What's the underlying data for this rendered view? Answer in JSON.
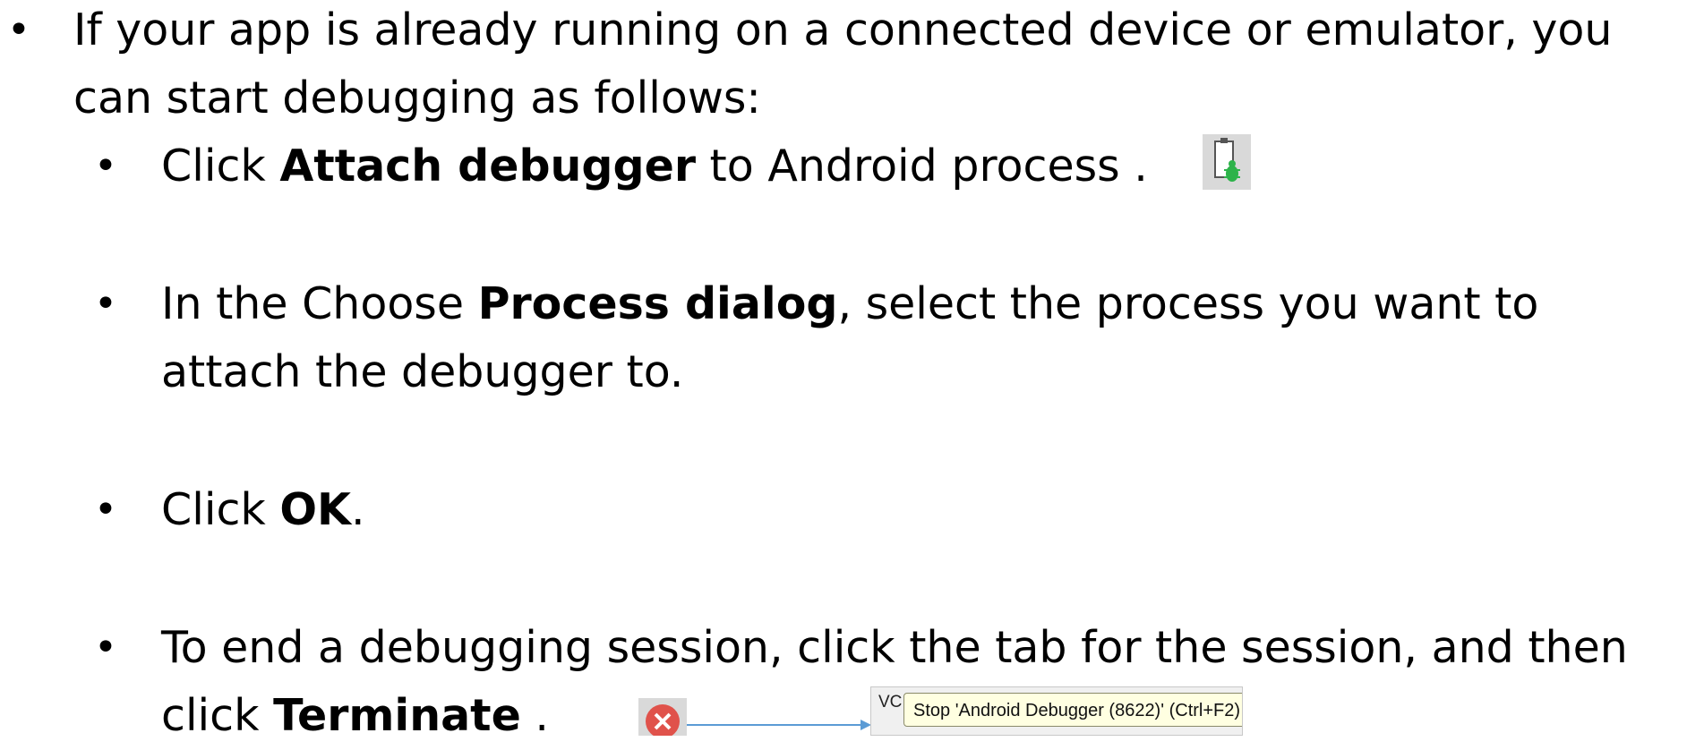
{
  "bullets": {
    "main": {
      "line1": "If your app is already running on a connected device or emulator, you",
      "line2": "can start debugging as follows:"
    },
    "attach": {
      "pre": "Click ",
      "bold": "Attach debugger",
      "post": " to Android process ."
    },
    "process": {
      "pre": "In the Choose ",
      "bold": "Process dialog",
      "post": ", select the process you want to",
      "line2": "attach the debugger to."
    },
    "ok": {
      "pre": "Click ",
      "bold": "OK",
      "post": "."
    },
    "terminate": {
      "line1": "To end a debugging session, click the tab for the session, and then",
      "pre": "click ",
      "bold": "Terminate",
      "post": " ."
    }
  },
  "tooltip": {
    "prefix": "VC",
    "text": "Stop 'Android Debugger (8622)' (Ctrl+F2)"
  },
  "icons": [
    "bullet-dot",
    "attach-debugger-icon",
    "terminate-icon",
    "arrow-icon"
  ],
  "colors": {
    "text": "#000000",
    "bug_green": "#2db34a",
    "terminate_red": "#e0524b",
    "arrow_blue": "#5b9bd5",
    "tooltip_bg": "#ffffe1"
  }
}
